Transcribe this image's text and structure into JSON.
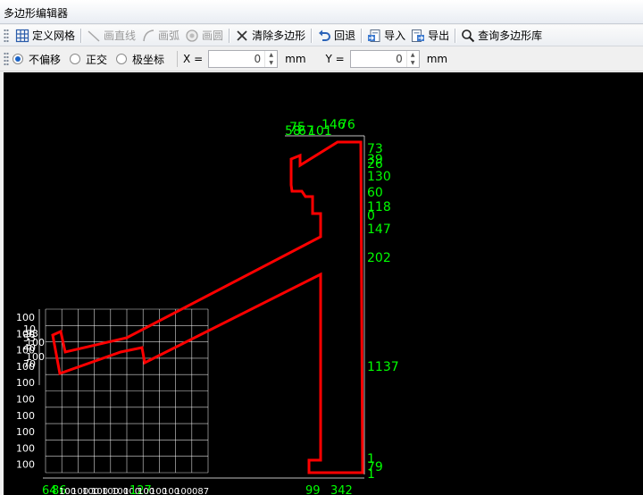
{
  "window": {
    "title": "多边形编辑器"
  },
  "toolbar": {
    "define_grid": "定义网格",
    "draw_line": "画直线",
    "draw_arc": "画弧",
    "draw_circle": "画圆",
    "clear_polygon": "清除多边形",
    "undo": "回退",
    "import": "导入",
    "export": "导出",
    "query_library": "查询多边形库"
  },
  "options": {
    "no_offset": "不偏移",
    "orthogonal": "正交",
    "polar": "极坐标",
    "selected": "no_offset",
    "x_label": "X =",
    "x_value": "0",
    "x_unit": "mm",
    "y_label": "Y =",
    "y_value": "0",
    "y_unit": "mm"
  },
  "drawing": {
    "grid_row_labels": [
      "100",
      "100",
      "100",
      "100",
      "100",
      "100",
      "100",
      "100",
      "100",
      "100"
    ],
    "left_overlap_labels": [
      "10",
      "93",
      "53",
      "100",
      "40",
      "100",
      "70"
    ],
    "top_dims": [
      "58",
      "67",
      "101",
      "146",
      "76",
      "75"
    ],
    "right_dims": [
      "73",
      "39",
      "26",
      "130",
      "60",
      "118",
      "0",
      "147",
      "202",
      "1137",
      "1",
      "79",
      "1"
    ],
    "bottom_dims": [
      "64",
      "86",
      "100",
      "100",
      "100",
      "100",
      "100",
      "100",
      "100",
      "127",
      "100",
      "100",
      "100",
      "100",
      "087",
      "99",
      "342"
    ],
    "colors": {
      "polygon": "#ff0000",
      "dimension": "#00ff00",
      "grid": "#ffffff",
      "background": "#000000"
    }
  }
}
